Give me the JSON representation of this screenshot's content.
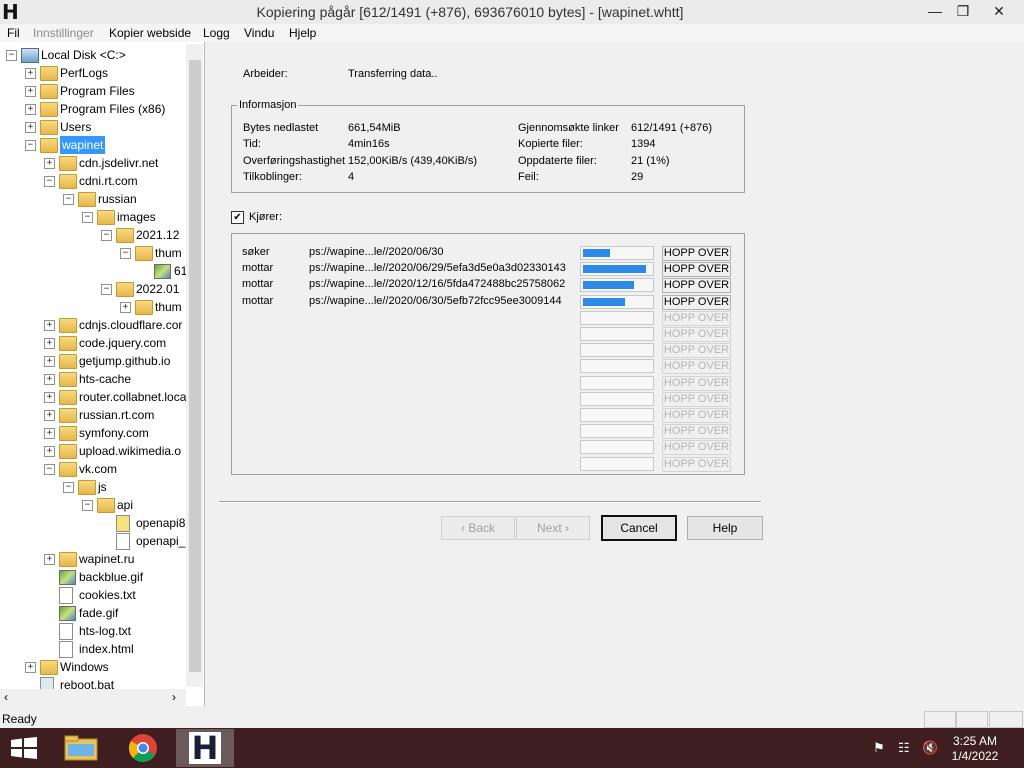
{
  "window": {
    "title": "Kopiering pågår [612/1491 (+876), 693676010 bytes] - [wapinet.whtt]",
    "app_icon": "H"
  },
  "menu": [
    "Fil",
    "Innstillinger",
    "Kopier webside",
    "Logg",
    "Vindu",
    "Hjelp"
  ],
  "tree": [
    {
      "label": "Local Disk <C:>",
      "icon": "disk-icon"
    },
    {
      "label": "PerfLogs",
      "icon": "folder-icon"
    },
    {
      "label": "Program Files",
      "icon": "folder-icon"
    },
    {
      "label": "Program Files (x86)",
      "icon": "folder-icon"
    },
    {
      "label": "Users",
      "icon": "folder-icon"
    },
    {
      "label": "wapinet",
      "icon": "folder-icon",
      "selected": true
    },
    {
      "label": "cdn.jsdelivr.net",
      "icon": "folder-icon"
    },
    {
      "label": "cdni.rt.com",
      "icon": "folder-icon"
    },
    {
      "label": "russian",
      "icon": "folder-icon"
    },
    {
      "label": "images",
      "icon": "folder-icon"
    },
    {
      "label": "2021.12",
      "icon": "folder-icon"
    },
    {
      "label": "thum",
      "icon": "folder-icon"
    },
    {
      "label": "61",
      "icon": "image-file-icon"
    },
    {
      "label": "2022.01",
      "icon": "folder-icon"
    },
    {
      "label": "thum",
      "icon": "folder-icon"
    },
    {
      "label": "cdnjs.cloudflare.cor",
      "icon": "folder-icon"
    },
    {
      "label": "code.jquery.com",
      "icon": "folder-icon"
    },
    {
      "label": "getjump.github.io",
      "icon": "folder-icon"
    },
    {
      "label": "hts-cache",
      "icon": "folder-icon"
    },
    {
      "label": "router.collabnet.loca",
      "icon": "folder-icon"
    },
    {
      "label": "russian.rt.com",
      "icon": "folder-icon"
    },
    {
      "label": "symfony.com",
      "icon": "folder-icon"
    },
    {
      "label": "upload.wikimedia.o",
      "icon": "folder-icon"
    },
    {
      "label": "vk.com",
      "icon": "folder-icon"
    },
    {
      "label": "js",
      "icon": "folder-icon"
    },
    {
      "label": "api",
      "icon": "folder-icon"
    },
    {
      "label": "openapi8",
      "icon": "script-file-icon"
    },
    {
      "label": "openapi_",
      "icon": "file-icon"
    },
    {
      "label": "wapinet.ru",
      "icon": "folder-icon"
    },
    {
      "label": "backblue.gif",
      "icon": "image-file-icon"
    },
    {
      "label": "cookies.txt",
      "icon": "file-icon"
    },
    {
      "label": "fade.gif",
      "icon": "image-file-icon"
    },
    {
      "label": "hts-log.txt",
      "icon": "file-icon"
    },
    {
      "label": "index.html",
      "icon": "file-icon"
    },
    {
      "label": "Windows",
      "icon": "folder-icon"
    },
    {
      "label": "reboot.bat",
      "icon": "gear-file-icon"
    }
  ],
  "status": {
    "label": "Arbeider:",
    "value": "Transferring data.."
  },
  "info": {
    "title": "Informasjon",
    "left": [
      {
        "label": "Bytes nedlastet",
        "value": "661,54MiB"
      },
      {
        "label": "Tid:",
        "value": "4min16s"
      },
      {
        "label": "Overføringshastighet",
        "value": "152,00KiB/s (439,40KiB/s)"
      },
      {
        "label": "Tilkoblinger:",
        "value": "4"
      }
    ],
    "right": [
      {
        "label": "Gjennomsøkte linker",
        "value": "612/1491 (+876)"
      },
      {
        "label": "Kopierte filer:",
        "value": "1394"
      },
      {
        "label": "Oppdaterte filer:",
        "value": "21 (1%)"
      },
      {
        "label": "Feil:",
        "value": "29"
      }
    ]
  },
  "running_checkbox": {
    "label": "Kjører:",
    "checked": true
  },
  "transfers": [
    {
      "action": "søker",
      "url": "ps://wapine...le//2020/06/30",
      "progress": 0.4
    },
    {
      "action": "mottar",
      "url": "ps://wapine...le//2020/06/29/5efa3d5e0a3d02330143",
      "progress": 0.92
    },
    {
      "action": "mottar",
      "url": "ps://wapine...le//2020/12/16/5fda472488bc25758062",
      "progress": 0.75
    },
    {
      "action": "mottar",
      "url": "ps://wapine...le//2020/06/30/5efb72fcc95ee3009144",
      "progress": 0.62
    }
  ],
  "skip_label": "HOPP OVER",
  "empty_slots": 10,
  "buttons": {
    "back": "‹ Back",
    "next": "Next ›",
    "cancel": "Cancel",
    "help": "Help"
  },
  "statusbar": {
    "text": "Ready"
  },
  "taskbar": {
    "time": "3:25 AM",
    "date": "1/4/2022"
  }
}
